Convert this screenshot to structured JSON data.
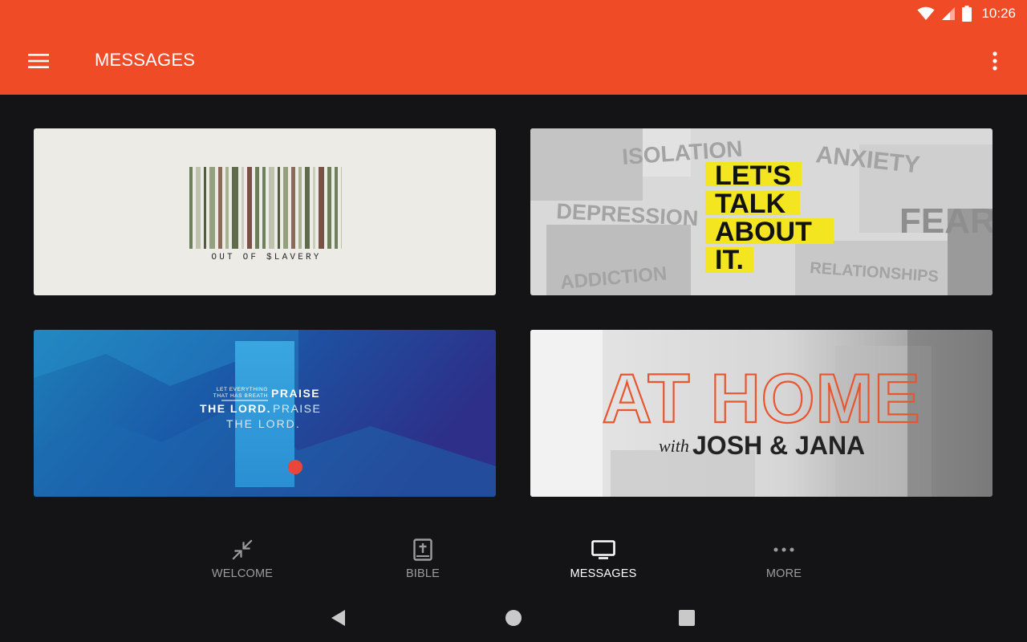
{
  "status_bar": {
    "time": "10:26",
    "icons": [
      "wifi-icon",
      "cell-signal-icon",
      "battery-icon"
    ]
  },
  "app_bar": {
    "title": "MESSAGES",
    "menu_icon": "hamburger-menu-icon",
    "overflow_icon": "more-vert-icon"
  },
  "cards": [
    {
      "id": "out-of-slavery",
      "title_text": "OUT OF $LAVERY"
    },
    {
      "id": "lets-talk-about-it",
      "title_lines": [
        "LET'S",
        "TALK",
        "ABOUT",
        "IT."
      ],
      "background_words": [
        "ISOLATION",
        "ANXIETY",
        "DEPRESSION",
        "FEAR",
        "RELATIONSHIPS",
        "ADDICTION"
      ]
    },
    {
      "id": "praise-the-lord",
      "small_lines": [
        "LET EVERYTHING",
        "THAT HAS BREATH"
      ],
      "line1": "PRAISE",
      "line2a": "THE LORD.",
      "line2b": "PRAISE",
      "line3": "THE LORD."
    },
    {
      "id": "at-home",
      "title": "AT HOME",
      "subtitle_with": "with",
      "subtitle_names": "JOSH & JANA"
    }
  ],
  "bottom_nav": [
    {
      "label": "WELCOME",
      "icon": "compress-arrows-icon",
      "active": false
    },
    {
      "label": "BIBLE",
      "icon": "bible-icon",
      "active": false
    },
    {
      "label": "MESSAGES",
      "icon": "tv-icon",
      "active": true
    },
    {
      "label": "MORE",
      "icon": "more-horiz-icon",
      "active": false
    }
  ],
  "system_nav": [
    "back-icon",
    "home-icon",
    "recents-icon"
  ],
  "colors": {
    "accent": "#ef4b27",
    "background": "#141416",
    "inactive_label": "#9c9c9e",
    "active_label": "#ffffff"
  }
}
